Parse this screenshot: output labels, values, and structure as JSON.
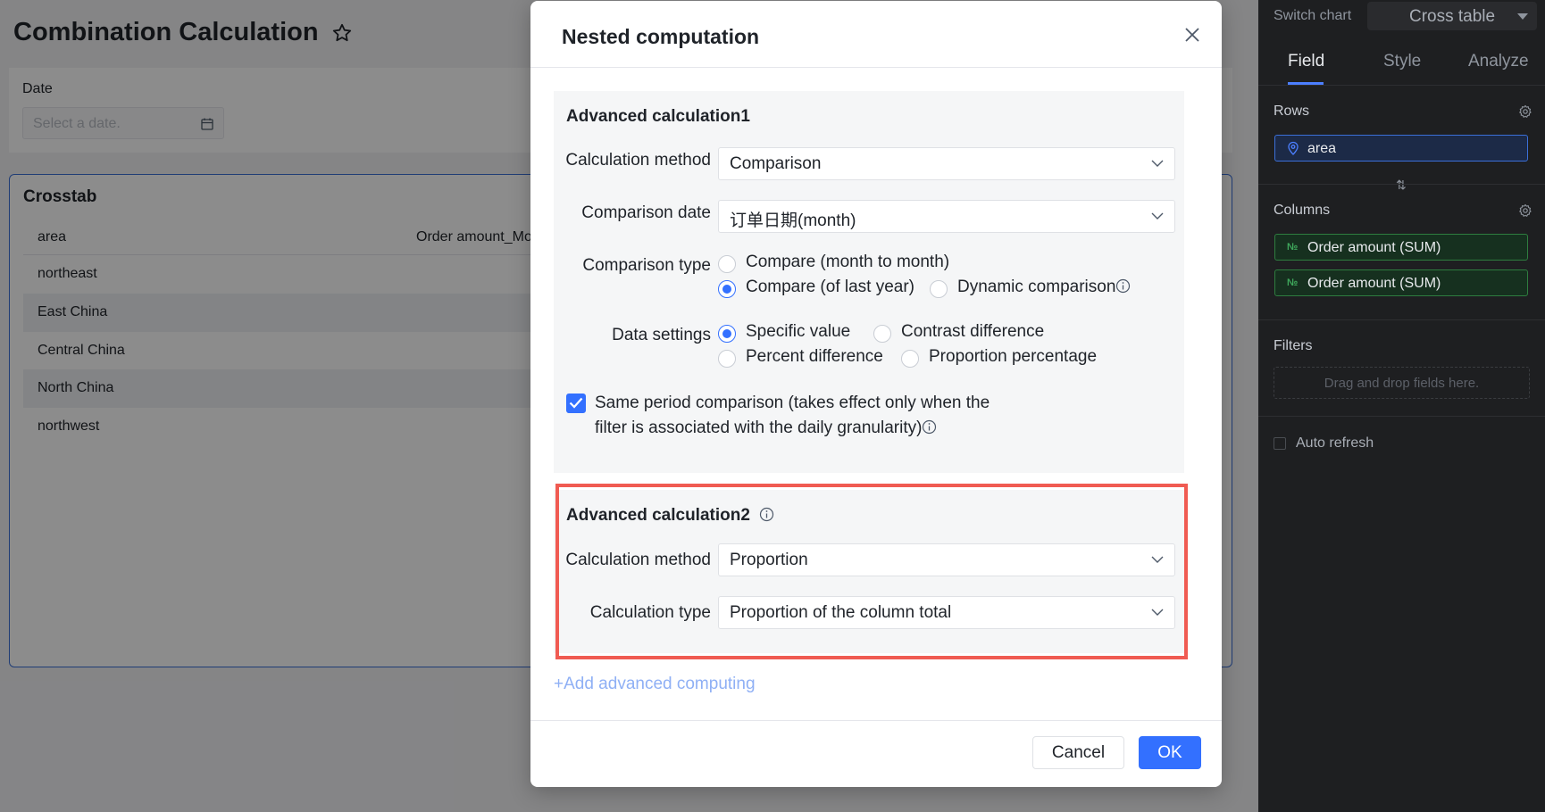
{
  "page": {
    "title": "Combination Calculation",
    "date_label": "Date",
    "date_placeholder": "Select a date."
  },
  "crosstab": {
    "title": "Crosstab",
    "columns": [
      "area",
      "Order amount_Mon"
    ],
    "rows": [
      "northeast",
      "East China",
      "Central China",
      "North China",
      "northwest"
    ]
  },
  "side": {
    "switch_label": "Switch chart",
    "switch_value": "Cross table",
    "tabs": [
      "Field",
      "Style",
      "Analyze"
    ],
    "rows_label": "Rows",
    "row_field": "area",
    "columns_label": "Columns",
    "column_fields": [
      "Order amount (SUM)",
      "Order amount (SUM)"
    ],
    "measure_icon_text": "№",
    "filters_label": "Filters",
    "filters_placeholder": "Drag and drop fields here.",
    "auto_refresh_label": "Auto refresh"
  },
  "modal": {
    "title": "Nested computation",
    "calc1": {
      "title": "Advanced calculation1",
      "method_label": "Calculation method",
      "method_value": "Comparison",
      "date_label": "Comparison date",
      "date_value": "订单日期(month)",
      "type_label": "Comparison type",
      "type_options": [
        "Compare (month to month)",
        "Compare (of last year)",
        "Dynamic comparison"
      ],
      "type_selected": 1,
      "data_label": "Data settings",
      "data_options": [
        "Specific value",
        "Contrast difference",
        "Percent difference",
        "Proportion percentage"
      ],
      "data_selected": 0,
      "same_period_line1": "Same period comparison (takes effect only when the",
      "same_period_line2": "filter is associated with the daily granularity)",
      "same_period_checked": true
    },
    "calc2": {
      "title": "Advanced calculation2",
      "method_label": "Calculation method",
      "method_value": "Proportion",
      "type_label": "Calculation type",
      "type_value": "Proportion of the column total"
    },
    "add_link": "+Add advanced computing",
    "cancel": "Cancel",
    "ok": "OK"
  },
  "colors": {
    "primary": "#3370ff",
    "highlight": "#f05b52",
    "panel_bg": "#1e1f21"
  }
}
